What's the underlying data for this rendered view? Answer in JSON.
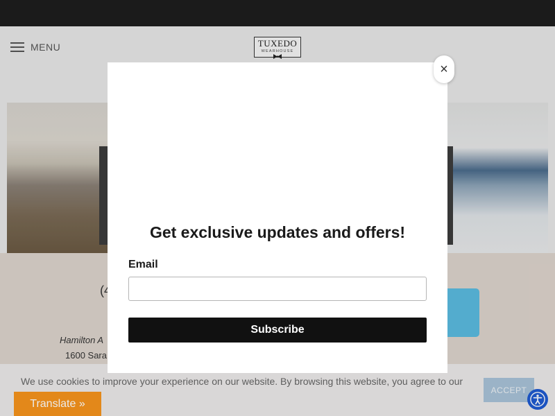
{
  "header": {
    "menu_label": "MENU",
    "logo_text": "TUXEDO",
    "logo_subtext": "WEARHOUSE"
  },
  "store_info": {
    "phone_fragment": "(4",
    "address_line1_fragment": "Hamilton A",
    "address_line2_fragment": "1600 Sara"
  },
  "cookie_banner": {
    "text": "We use cookies to improve your experience on our website. By browsing this website, you agree to our",
    "accept_label": "ACCEPT"
  },
  "translate_label": "Translate »",
  "modal": {
    "close_symbol": "×",
    "title": "Get exclusive updates and offers!",
    "email_label": "Email",
    "email_value": "",
    "subscribe_label": "Subscribe"
  },
  "colors": {
    "topbar": "#1e1e1e",
    "subscribe": "#111111",
    "translate": "#f7941d",
    "accept": "#a9c3d8",
    "accessibility": "#1f5bd1",
    "info_button": "#5bbbe0"
  },
  "icons": [
    "hamburger-icon",
    "bowtie-icon",
    "close-icon",
    "accessibility-icon"
  ]
}
